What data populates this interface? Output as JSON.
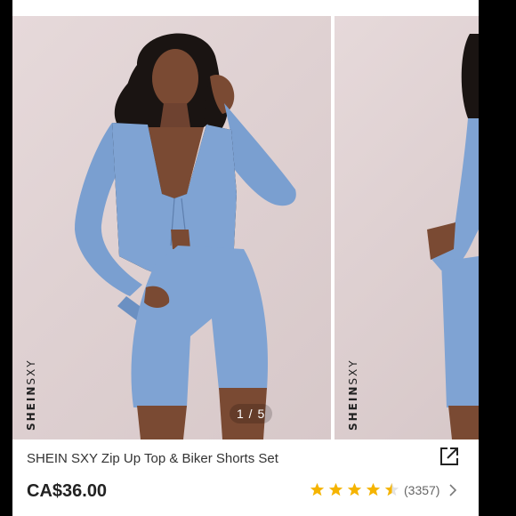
{
  "gallery": {
    "watermark_brand": "SHEIN",
    "watermark_sub": "SXY",
    "counter": "1 / 5"
  },
  "product": {
    "title": "SHEIN SXY Zip Up Top & Biker Shorts Set",
    "price": "CA$36.00",
    "rating_value": 4.5,
    "rating_count": "(3357)"
  },
  "icons": {
    "share": "share-icon",
    "star": "star-icon",
    "chevron": "chevron-right-icon"
  },
  "colors": {
    "star": "#f5b400",
    "outfit": "#7a9fd0",
    "background": "#e2d5d6"
  }
}
